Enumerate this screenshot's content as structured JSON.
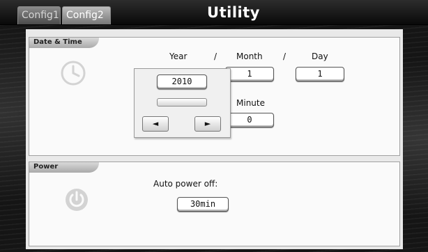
{
  "header": {
    "tabs": [
      {
        "label": "Config1",
        "selected": false
      },
      {
        "label": "Config2",
        "selected": true
      }
    ],
    "title": "Utility"
  },
  "date_time": {
    "section_label": "Date & Time",
    "icon": "clock-icon",
    "year_label": "Year",
    "month_label": "Month",
    "day_label": "Day",
    "separator": "/",
    "year_value": "2010",
    "month_value": "1",
    "day_value": "1",
    "minute_label": "Minute",
    "minute_value": "0",
    "popup": {
      "left_arrow": "◄",
      "right_arrow": "►"
    }
  },
  "power": {
    "section_label": "Power",
    "icon": "power-icon",
    "auto_power_off_label": "Auto power off:",
    "auto_power_off_value": "30min"
  },
  "colors": {
    "background": "#1b1b1b",
    "panel": "#fafafa",
    "icon_gray": "#d0d0d0"
  }
}
